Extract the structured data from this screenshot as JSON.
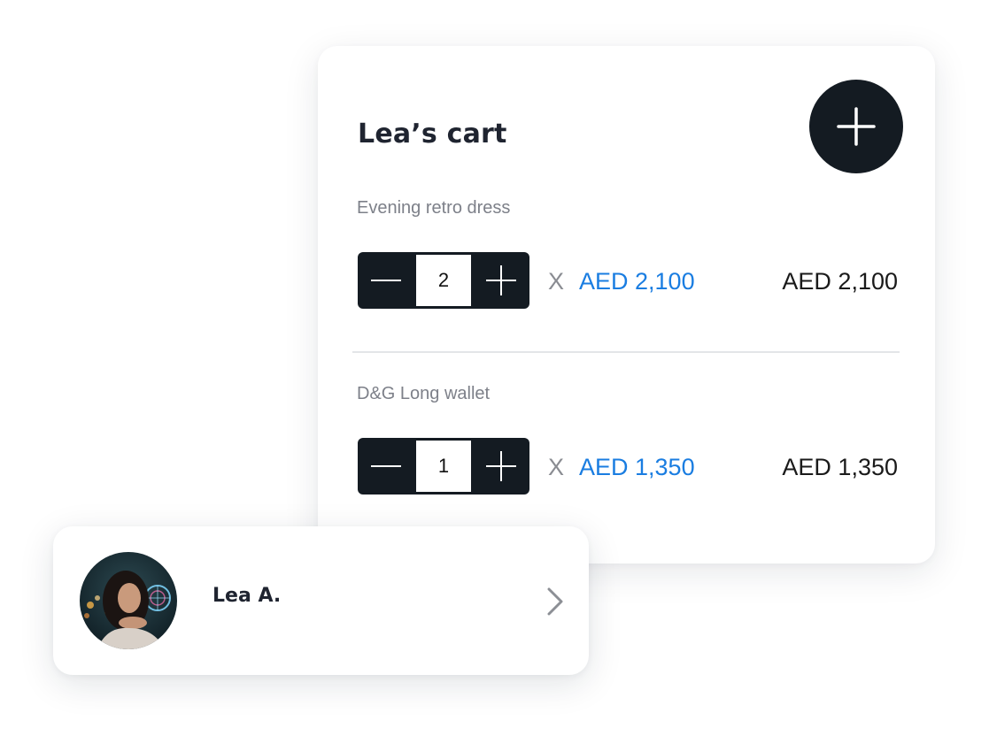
{
  "cart": {
    "title": "Lea’s cart",
    "add_icon": "plus-icon",
    "items": [
      {
        "name": "Evening retro dress",
        "quantity": "2",
        "times": "X",
        "unit_price": "AED 2,100",
        "line_total": "AED 2,100"
      },
      {
        "name": "D&G Long wallet",
        "quantity": "1",
        "times": "X",
        "unit_price": "AED 1,350",
        "line_total": "AED 1,350"
      }
    ]
  },
  "user": {
    "name": "Lea A.",
    "chevron_icon": "chevron-right-icon"
  },
  "colors": {
    "dark": "#141b22",
    "accent_price": "#1a7de1",
    "muted_text": "#7d8089"
  }
}
